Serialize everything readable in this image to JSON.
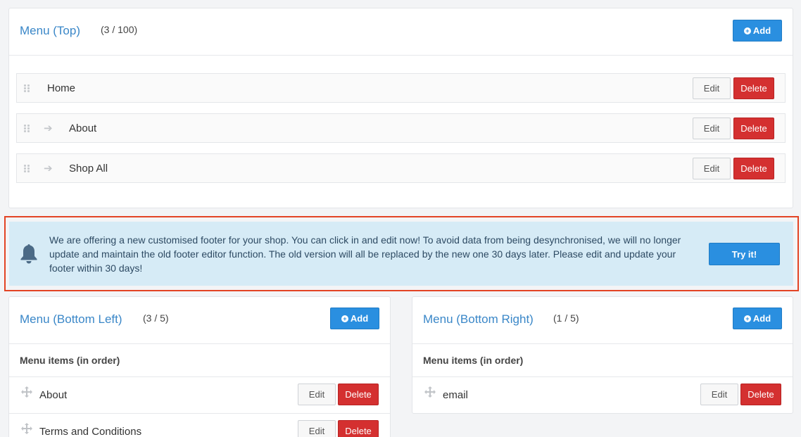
{
  "menu_top": {
    "title": "Menu (Top)",
    "count": "(3 / 100)",
    "add_label": "Add",
    "items": [
      {
        "label": "Home",
        "edit": "Edit",
        "delete": "Delete"
      },
      {
        "label": "About",
        "edit": "Edit",
        "delete": "Delete"
      },
      {
        "label": "Shop All",
        "edit": "Edit",
        "delete": "Delete"
      }
    ]
  },
  "notice": {
    "text": "We are offering a new customised footer for your shop. You can click in and edit now! To avoid data from being desynchronised, we will no longer update and maintain the old footer editor function. The old version will all be replaced by the new one 30 days later. Please edit and update your footer within 30 days!",
    "button": "Try it!",
    "highlight_color": "#e34424"
  },
  "menu_bottom_left": {
    "title": "Menu (Bottom Left)",
    "count": "(3 / 5)",
    "add_label": "Add",
    "subheader": "Menu items (in order)",
    "items": [
      {
        "label": "About",
        "edit": "Edit",
        "delete": "Delete"
      },
      {
        "label": "Terms and Conditions",
        "edit": "Edit",
        "delete": "Delete"
      }
    ]
  },
  "menu_bottom_right": {
    "title": "Menu (Bottom Right)",
    "count": "(1 / 5)",
    "add_label": "Add",
    "subheader": "Menu items (in order)",
    "items": [
      {
        "label": "email",
        "edit": "Edit",
        "delete": "Delete"
      }
    ]
  },
  "colors": {
    "accent": "#2a8fe0",
    "danger": "#d43030",
    "title": "#3a87c8"
  }
}
